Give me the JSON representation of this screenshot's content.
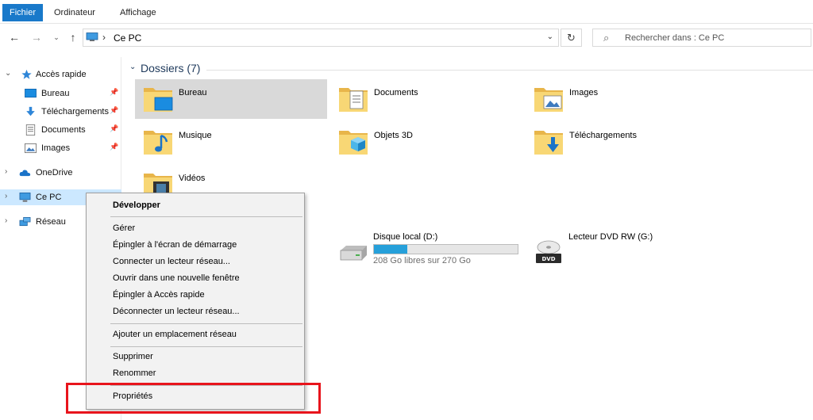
{
  "ribbon": {
    "tabs": [
      "Fichier",
      "Ordinateur",
      "Affichage"
    ]
  },
  "address": {
    "crumb": "Ce PC",
    "separator": "›"
  },
  "search": {
    "placeholder": "Rechercher dans : Ce PC"
  },
  "sidebar": {
    "items": [
      {
        "label": "Accès rapide",
        "icon": "star-icon"
      },
      {
        "label": "Bureau",
        "icon": "desktop-icon",
        "pinned": true
      },
      {
        "label": "Téléchargements",
        "icon": "download-arrow-icon",
        "pinned": true
      },
      {
        "label": "Documents",
        "icon": "document-icon",
        "pinned": true
      },
      {
        "label": "Images",
        "icon": "image-icon",
        "pinned": true
      },
      {
        "label": "OneDrive",
        "icon": "cloud-icon"
      },
      {
        "label": "Ce PC",
        "icon": "computer-icon"
      },
      {
        "label": "Réseau",
        "icon": "network-icon"
      }
    ]
  },
  "content": {
    "folders_header": "Dossiers (7)",
    "folders": [
      {
        "name": "Bureau",
        "icon": "desktop-folder-icon"
      },
      {
        "name": "Documents",
        "icon": "documents-folder-icon"
      },
      {
        "name": "Images",
        "icon": "images-folder-icon"
      },
      {
        "name": "Musique",
        "icon": "music-folder-icon"
      },
      {
        "name": "Objets 3D",
        "icon": "3d-objects-folder-icon"
      },
      {
        "name": "Téléchargements",
        "icon": "downloads-folder-icon"
      },
      {
        "name": "Vidéos",
        "icon": "videos-folder-icon"
      }
    ],
    "drives": [
      {
        "name": "Disque local (D:)",
        "free": "208 Go libres sur 270 Go",
        "used_fraction": 0.23,
        "icon": "hard-drive-icon"
      },
      {
        "name": "Lecteur DVD RW (G:)",
        "icon": "dvd-drive-icon",
        "dvd_label": "DVD"
      }
    ]
  },
  "context_menu": {
    "items": [
      "Développer",
      "Gérer",
      "Épingler à l'écran de démarrage",
      "Connecter un lecteur réseau...",
      "Ouvrir dans une nouvelle fenêtre",
      "Épingler à Accès rapide",
      "Déconnecter un lecteur réseau...",
      "Ajouter un emplacement réseau",
      "Supprimer",
      "Renommer",
      "Propriétés"
    ]
  },
  "colors": {
    "accent": "#1979ca",
    "selection": "#cce8ff",
    "highlight_box": "#e8141c",
    "drive_bar": "#26a0da"
  }
}
